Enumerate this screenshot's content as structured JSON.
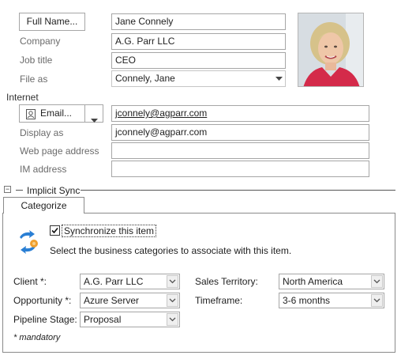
{
  "contact": {
    "full_name_button": "Full Name...",
    "full_name_value": "Jane Connely",
    "company_label": "Company",
    "company_value": "A.G. Parr LLC",
    "job_title_label": "Job title",
    "job_title_value": "CEO",
    "file_as_label": "File as",
    "file_as_value": "Connely, Jane"
  },
  "internet": {
    "section_label": "Internet",
    "email_button": "Email...",
    "email_value": "jconnely@agparr.com",
    "display_as_label": "Display as",
    "display_as_value": "jconnely@agparr.com",
    "web_page_label": "Web page address",
    "web_page_value": "",
    "im_label": "IM address",
    "im_value": ""
  },
  "implicit_sync": {
    "section_title": "Implicit Sync",
    "collapse_glyph": "−",
    "tab_label": "Categorize",
    "sync_checkbox_label": "Synchronize this item",
    "sync_checked": true,
    "instruction": "Select the business categories to associate with this item.",
    "fields": {
      "client_label": "Client *:",
      "client_value": "A.G. Parr LLC",
      "opportunity_label": "Opportunity *:",
      "opportunity_value": "Azure Server",
      "pipeline_label": "Pipeline Stage:",
      "pipeline_value": "Proposal",
      "territory_label": "Sales Territory:",
      "territory_value": "North America",
      "timeframe_label": "Timeframe:",
      "timeframe_value": "3-6 months"
    },
    "mandatory_note": "* mandatory"
  },
  "icons": {
    "dropdown": "chevron-down-icon",
    "contact_card": "contact-card-icon",
    "sync": "sync-arrows-icon",
    "photo": "contact-photo"
  },
  "colors": {
    "sync_blue": "#2a7fd4",
    "sync_orange": "#f0a030",
    "border": "#a6a6a6"
  }
}
